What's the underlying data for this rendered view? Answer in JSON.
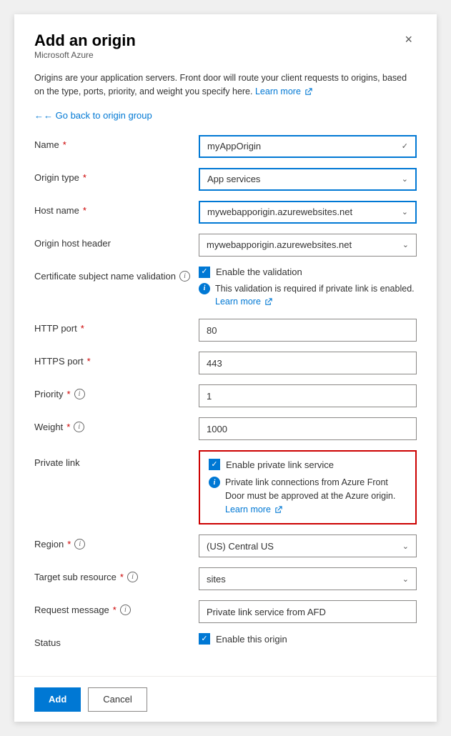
{
  "panel": {
    "title": "Add an origin",
    "subtitle": "Microsoft Azure",
    "close_label": "×",
    "description": "Origins are your application servers. Front door will route your client requests to origins, based on the type, ports, priority, and weight you specify here.",
    "learn_more_1": "Learn more",
    "back_link": "← Go back to origin group"
  },
  "fields": {
    "name": {
      "label": "Name",
      "required": true,
      "value": "myAppOrigin",
      "type": "dropdown"
    },
    "origin_type": {
      "label": "Origin type",
      "required": true,
      "value": "App services",
      "type": "dropdown"
    },
    "host_name": {
      "label": "Host name",
      "required": true,
      "value": "mywebapporigin.azurewebsites.net",
      "type": "dropdown"
    },
    "origin_host_header": {
      "label": "Origin host header",
      "required": false,
      "value": "mywebapporigin.azurewebsites.net",
      "type": "dropdown"
    },
    "cert_validation": {
      "label": "Certificate subject name validation",
      "has_info": true,
      "checkbox_label": "Enable the validation",
      "checked": true,
      "info_text": "This validation is required if private link is enabled.",
      "learn_more": "Learn more"
    },
    "http_port": {
      "label": "HTTP port",
      "required": true,
      "value": "80"
    },
    "https_port": {
      "label": "HTTPS port",
      "required": true,
      "value": "443"
    },
    "priority": {
      "label": "Priority",
      "required": true,
      "has_info": true,
      "value": "1"
    },
    "weight": {
      "label": "Weight",
      "required": true,
      "has_info": true,
      "value": "1000"
    },
    "private_link": {
      "label": "Private link",
      "checkbox_label": "Enable private link service",
      "checked": true,
      "info_text": "Private link connections from Azure Front Door must be approved at the Azure origin.",
      "learn_more": "Learn more"
    },
    "region": {
      "label": "Region",
      "required": true,
      "has_info": true,
      "value": "(US) Central US",
      "type": "dropdown"
    },
    "target_sub_resource": {
      "label": "Target sub resource",
      "required": true,
      "has_info": true,
      "value": "sites",
      "type": "dropdown"
    },
    "request_message": {
      "label": "Request message",
      "required": true,
      "has_info": true,
      "value": "Private link service from AFD"
    },
    "status": {
      "label": "Status",
      "checkbox_label": "Enable this origin",
      "checked": true
    }
  },
  "footer": {
    "add_label": "Add",
    "cancel_label": "Cancel"
  },
  "icons": {
    "external_link": "↗",
    "check": "✓",
    "caret_down": "∨",
    "back_arrow": "←",
    "info_i": "i"
  }
}
